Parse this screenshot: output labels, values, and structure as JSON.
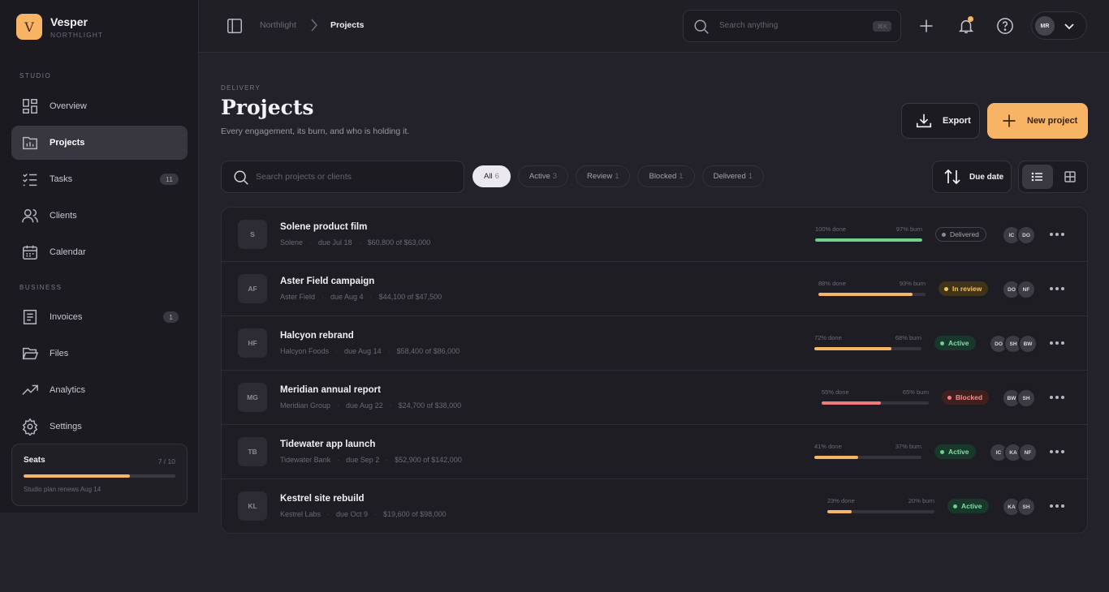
{
  "brand": {
    "logo_letter": "V",
    "name": "Vesper",
    "subtitle": "NORTHLIGHT"
  },
  "sidebar": {
    "section_studio": "STUDIO",
    "section_business": "BUSINESS",
    "items": [
      {
        "label": "Overview",
        "icon": "grid-icon",
        "badge": ""
      },
      {
        "label": "Projects",
        "icon": "folder-chart-icon",
        "badge": "",
        "active": true
      },
      {
        "label": "Tasks",
        "icon": "checklist-icon",
        "badge": "11"
      },
      {
        "label": "Clients",
        "icon": "users-icon",
        "badge": ""
      },
      {
        "label": "Calendar",
        "icon": "calendar-icon",
        "badge": ""
      },
      {
        "label": "Invoices",
        "icon": "receipt-icon",
        "badge": "1"
      },
      {
        "label": "Files",
        "icon": "folder-open-icon",
        "badge": ""
      },
      {
        "label": "Analytics",
        "icon": "trend-icon",
        "badge": ""
      },
      {
        "label": "Settings",
        "icon": "gear-icon",
        "badge": ""
      }
    ],
    "seats": {
      "title": "Seats",
      "count": "7 / 10",
      "fraction": 0.7,
      "note": "Studio plan renews Aug 14"
    }
  },
  "topbar": {
    "breadcrumb": [
      "Northlight",
      "Projects"
    ],
    "search_placeholder": "Search anything",
    "search_kbd": "⌘K",
    "account_initials": "MR"
  },
  "header": {
    "eyebrow": "DELIVERY",
    "title": "Projects",
    "subtitle": "Every engagement, its burn, and who is holding it.",
    "export_label": "Export",
    "new_label": "New project"
  },
  "filters": {
    "search_placeholder": "Search projects or clients",
    "chips": [
      {
        "label": "All",
        "count": "6",
        "active": true
      },
      {
        "label": "Active",
        "count": "3"
      },
      {
        "label": "Review",
        "count": "1"
      },
      {
        "label": "Blocked",
        "count": "1"
      },
      {
        "label": "Delivered",
        "count": "1"
      }
    ],
    "sort_label": "Due date"
  },
  "colors": {
    "accent": "#f7b465",
    "green": "#6fcf8f",
    "red": "#f07b7b"
  },
  "projects": [
    {
      "initials": "S",
      "name": "Solene product film",
      "client": "Solene",
      "due": "due Jul 18",
      "budget": "$60,800 of $63,000",
      "done_label": "100% done",
      "burn_label": "97% burn",
      "done": 1.0,
      "bar_color": "#6fcf8f",
      "status": "Delivered",
      "status_type": "delivered",
      "avatars": [
        "IC",
        "DO"
      ]
    },
    {
      "initials": "AF",
      "name": "Aster Field campaign",
      "client": "Aster Field",
      "due": "due Aug 4",
      "budget": "$44,100 of $47,500",
      "done_label": "88% done",
      "burn_label": "93% burn",
      "done": 0.88,
      "bar_color": "#f7b465",
      "status": "In review",
      "status_type": "review",
      "avatars": [
        "DO",
        "NF"
      ]
    },
    {
      "initials": "HF",
      "name": "Halcyon rebrand",
      "client": "Halcyon Foods",
      "due": "due Aug 14",
      "budget": "$58,400 of $86,000",
      "done_label": "72% done",
      "burn_label": "68% burn",
      "done": 0.72,
      "bar_color": "#f7b465",
      "status": "Active",
      "status_type": "active",
      "avatars": [
        "DO",
        "SH",
        "BW"
      ]
    },
    {
      "initials": "MG",
      "name": "Meridian annual report",
      "client": "Meridian Group",
      "due": "due Aug 22",
      "budget": "$24,700 of $38,000",
      "done_label": "55% done",
      "burn_label": "65% burn",
      "done": 0.55,
      "bar_color": "#f07b7b",
      "status": "Blocked",
      "status_type": "blocked",
      "avatars": [
        "BW",
        "SH"
      ]
    },
    {
      "initials": "TB",
      "name": "Tidewater app launch",
      "client": "Tidewater Bank",
      "due": "due Sep 2",
      "budget": "$52,900 of $142,000",
      "done_label": "41% done",
      "burn_label": "37% burn",
      "done": 0.41,
      "bar_color": "#f7b465",
      "status": "Active",
      "status_type": "active",
      "avatars": [
        "IC",
        "KA",
        "NF"
      ]
    },
    {
      "initials": "KL",
      "name": "Kestrel site rebuild",
      "client": "Kestrel Labs",
      "due": "due Oct 9",
      "budget": "$19,600 of $98,000",
      "done_label": "23% done",
      "burn_label": "20% burn",
      "done": 0.23,
      "bar_color": "#f7b465",
      "status": "Active",
      "status_type": "active",
      "avatars": [
        "KA",
        "SH"
      ]
    }
  ]
}
